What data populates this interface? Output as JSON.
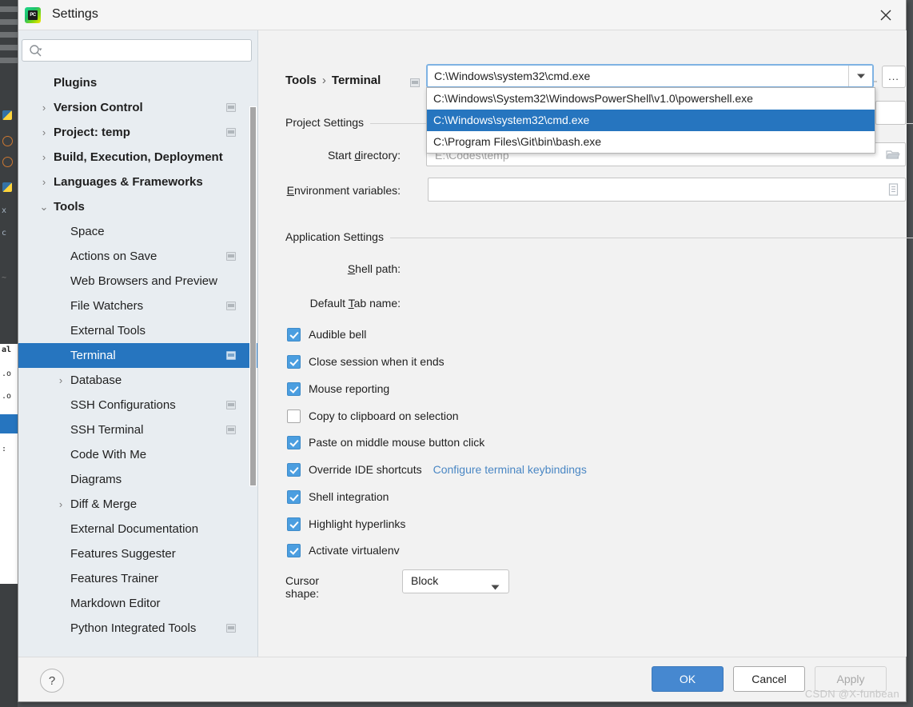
{
  "window": {
    "title": "Settings",
    "logo_text": "PC",
    "close_icon": "close-icon"
  },
  "sidebar": {
    "search": {
      "value": "",
      "placeholder": ""
    },
    "items": [
      {
        "label": "Plugins",
        "indent": 44,
        "bold": true,
        "arrow": "",
        "badge": false,
        "selected": false
      },
      {
        "label": "Version Control",
        "indent": 44,
        "bold": true,
        "arrow": "›",
        "badge": true,
        "selected": false
      },
      {
        "label": "Project: temp",
        "indent": 44,
        "bold": true,
        "arrow": "›",
        "badge": true,
        "selected": false
      },
      {
        "label": "Build, Execution, Deployment",
        "indent": 44,
        "bold": true,
        "arrow": "›",
        "badge": false,
        "selected": false
      },
      {
        "label": "Languages & Frameworks",
        "indent": 44,
        "bold": true,
        "arrow": "›",
        "badge": false,
        "selected": false
      },
      {
        "label": "Tools",
        "indent": 44,
        "bold": true,
        "arrow": "⌄",
        "badge": false,
        "selected": false
      },
      {
        "label": "Space",
        "indent": 65,
        "bold": false,
        "arrow": "",
        "badge": false,
        "selected": false
      },
      {
        "label": "Actions on Save",
        "indent": 65,
        "bold": false,
        "arrow": "",
        "badge": true,
        "selected": false
      },
      {
        "label": "Web Browsers and Preview",
        "indent": 65,
        "bold": false,
        "arrow": "",
        "badge": false,
        "selected": false
      },
      {
        "label": "File Watchers",
        "indent": 65,
        "bold": false,
        "arrow": "",
        "badge": true,
        "selected": false
      },
      {
        "label": "External Tools",
        "indent": 65,
        "bold": false,
        "arrow": "",
        "badge": false,
        "selected": false
      },
      {
        "label": "Terminal",
        "indent": 65,
        "bold": false,
        "arrow": "",
        "badge": true,
        "selected": true
      },
      {
        "label": "Database",
        "indent": 65,
        "bold": false,
        "arrow": "›",
        "badge": false,
        "selected": false
      },
      {
        "label": "SSH Configurations",
        "indent": 65,
        "bold": false,
        "arrow": "",
        "badge": true,
        "selected": false
      },
      {
        "label": "SSH Terminal",
        "indent": 65,
        "bold": false,
        "arrow": "",
        "badge": true,
        "selected": false
      },
      {
        "label": "Code With Me",
        "indent": 65,
        "bold": false,
        "arrow": "",
        "badge": false,
        "selected": false
      },
      {
        "label": "Diagrams",
        "indent": 65,
        "bold": false,
        "arrow": "",
        "badge": false,
        "selected": false
      },
      {
        "label": "Diff & Merge",
        "indent": 65,
        "bold": false,
        "arrow": "›",
        "badge": false,
        "selected": false
      },
      {
        "label": "External Documentation",
        "indent": 65,
        "bold": false,
        "arrow": "",
        "badge": false,
        "selected": false
      },
      {
        "label": "Features Suggester",
        "indent": 65,
        "bold": false,
        "arrow": "",
        "badge": false,
        "selected": false
      },
      {
        "label": "Features Trainer",
        "indent": 65,
        "bold": false,
        "arrow": "",
        "badge": false,
        "selected": false
      },
      {
        "label": "Markdown Editor",
        "indent": 65,
        "bold": false,
        "arrow": "",
        "badge": false,
        "selected": false
      },
      {
        "label": "Python Integrated Tools",
        "indent": 65,
        "bold": false,
        "arrow": "",
        "badge": true,
        "selected": false
      }
    ]
  },
  "breadcrumb": {
    "root": "Tools",
    "separator": "›",
    "current": "Terminal"
  },
  "nav": {
    "back_icon": "arrow-left-icon",
    "forward_icon": "arrow-right-icon"
  },
  "project_settings": {
    "group_title": "Project Settings",
    "start_directory": {
      "label_pre": "Start ",
      "label_accel": "d",
      "label_post": "irectory:",
      "value": "",
      "placeholder": "E:\\Codes\\temp",
      "button_icon": "folder-icon"
    },
    "environment_variables": {
      "label_pre": "",
      "label_accel": "E",
      "label_post": "nvironment variables:",
      "value": "",
      "placeholder": "",
      "button_icon": "list-icon"
    }
  },
  "application_settings": {
    "group_title": "Application Settings",
    "shell_path": {
      "label_pre": "",
      "label_accel": "S",
      "label_post": "hell path:",
      "value": "C:\\Windows\\system32\\cmd.exe",
      "dropdown_icon": "chevron-down-icon",
      "browse_label": "...",
      "options": [
        {
          "label": "C:\\Windows\\System32\\WindowsPowerShell\\v1.0\\powershell.exe",
          "selected": false
        },
        {
          "label": "C:\\Windows\\system32\\cmd.exe",
          "selected": true
        },
        {
          "label": "C:\\Program Files\\Git\\bin\\bash.exe",
          "selected": false
        }
      ]
    },
    "default_tab_name": {
      "label_pre": "Default ",
      "label_accel": "T",
      "label_post": "ab name:",
      "value": ""
    },
    "checkboxes": [
      {
        "label": "Audible bell",
        "checked": true,
        "link": ""
      },
      {
        "label": "Close session when it ends",
        "checked": true,
        "link": ""
      },
      {
        "label": "Mouse reporting",
        "checked": true,
        "link": ""
      },
      {
        "label": "Copy to clipboard on selection",
        "checked": false,
        "link": ""
      },
      {
        "label": "Paste on middle mouse button click",
        "checked": true,
        "link": ""
      },
      {
        "label": "Override IDE shortcuts",
        "checked": true,
        "link": "Configure terminal keybindings"
      },
      {
        "label": "Shell integration",
        "checked": true,
        "link": ""
      },
      {
        "label": "Highlight hyperlinks",
        "checked": true,
        "link": ""
      },
      {
        "label": "Activate virtualenv",
        "checked": true,
        "link": ""
      }
    ],
    "cursor_shape": {
      "label": "Cursor shape:",
      "value": "Block",
      "dropdown_icon": "chevron-down-icon"
    }
  },
  "footer": {
    "help_label": "?",
    "ok_label": "OK",
    "cancel_label": "Cancel",
    "apply_label": "Apply",
    "watermark": "CSDN @X-funbean"
  },
  "colors": {
    "accent": "#2675bf",
    "ok_button": "#4688d0",
    "link": "#4a87c4",
    "checkbox_on": "#4b9ee0",
    "sidebar_bg": "#e8edf1",
    "panel_bg": "#f2f2f2"
  }
}
